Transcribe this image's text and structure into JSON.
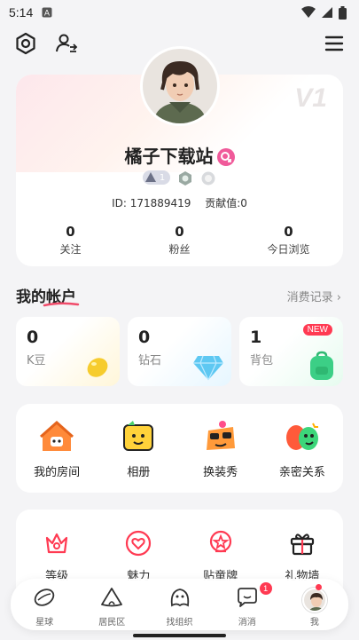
{
  "status_bar": {
    "time": "5:14"
  },
  "profile": {
    "watermark": "V1",
    "name": "橘子下载站",
    "level": "1",
    "id_text": "ID: 171889419",
    "contribution_text": "贡献值:0",
    "stats": [
      {
        "value": "0",
        "label": "关注"
      },
      {
        "value": "0",
        "label": "粉丝"
      },
      {
        "value": "0",
        "label": "今日浏览"
      }
    ]
  },
  "account": {
    "title": "我的帐户",
    "link": "消费记录 ›",
    "items": [
      {
        "value": "0",
        "label": "K豆"
      },
      {
        "value": "0",
        "label": "钻石"
      },
      {
        "value": "1",
        "label": "背包",
        "badge": "NEW"
      }
    ]
  },
  "features": [
    {
      "label": "我的房间"
    },
    {
      "label": "相册"
    },
    {
      "label": "换装秀"
    },
    {
      "label": "亲密关系"
    }
  ],
  "more": [
    {
      "label": "等级"
    },
    {
      "label": "魅力"
    },
    {
      "label": "贴童牌"
    },
    {
      "label": "礼物墙"
    }
  ],
  "tabbar": [
    {
      "label": "星球"
    },
    {
      "label": "居民区"
    },
    {
      "label": "找组织"
    },
    {
      "label": "消消",
      "badge": "1"
    },
    {
      "label": "我"
    }
  ],
  "colors": {
    "accent": "#ff3a52",
    "gender": "#f05a9a"
  }
}
